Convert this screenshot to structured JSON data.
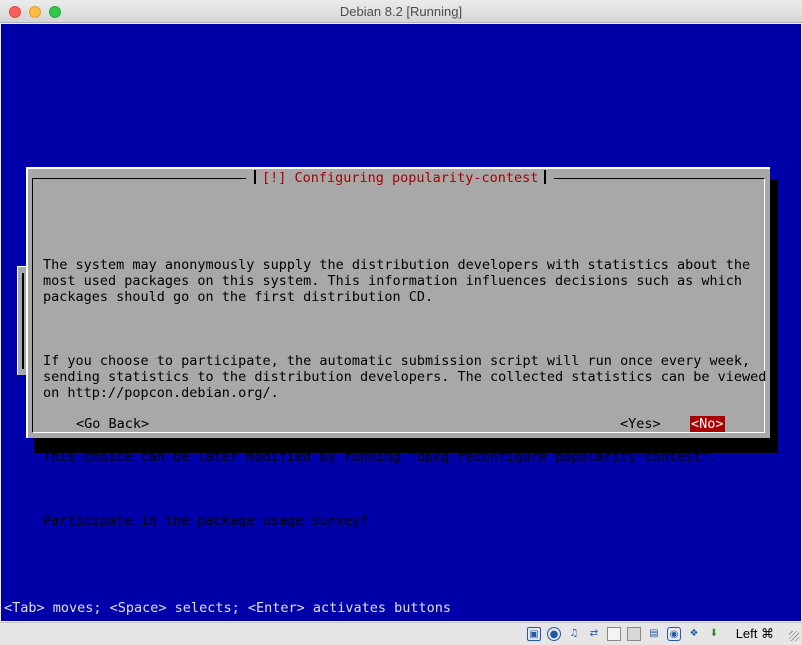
{
  "window": {
    "title": "Debian 8.2 [Running]"
  },
  "dialog": {
    "title": "[!] Configuring popularity-contest",
    "paragraphs": [
      "The system may anonymously supply the distribution developers with statistics about the\nmost used packages on this system. This information influences decisions such as which\npackages should go on the first distribution CD.",
      "If you choose to participate, the automatic submission script will run once every week,\nsending statistics to the distribution developers. The collected statistics can be viewed\non http://popcon.debian.org/.",
      "This choice can be later modified by running \"dpkg-reconfigure popularity-contest\".",
      "Participate in the package usage survey?"
    ],
    "buttons": {
      "back": "<Go Back>",
      "yes": "<Yes>",
      "no": "<No>"
    },
    "selected_button": "no"
  },
  "hint": "<Tab> moves; <Space> selects; <Enter> activates buttons",
  "statusbar": {
    "icons": [
      "hard-disk-icon",
      "optical-drive-icon",
      "audio-icon",
      "network-icon",
      "usb-icon",
      "shared-folders-icon",
      "display-icon",
      "video-capture-icon",
      "cpu-icon",
      "guest-additions-icon",
      "mouse-integration-icon"
    ],
    "host_key": "Left ⌘"
  },
  "colors": {
    "screen_bg": "#0000a8",
    "dialog_bg": "#a8a8a8",
    "title_fg": "#a80000",
    "selected_bg": "#a80000"
  }
}
